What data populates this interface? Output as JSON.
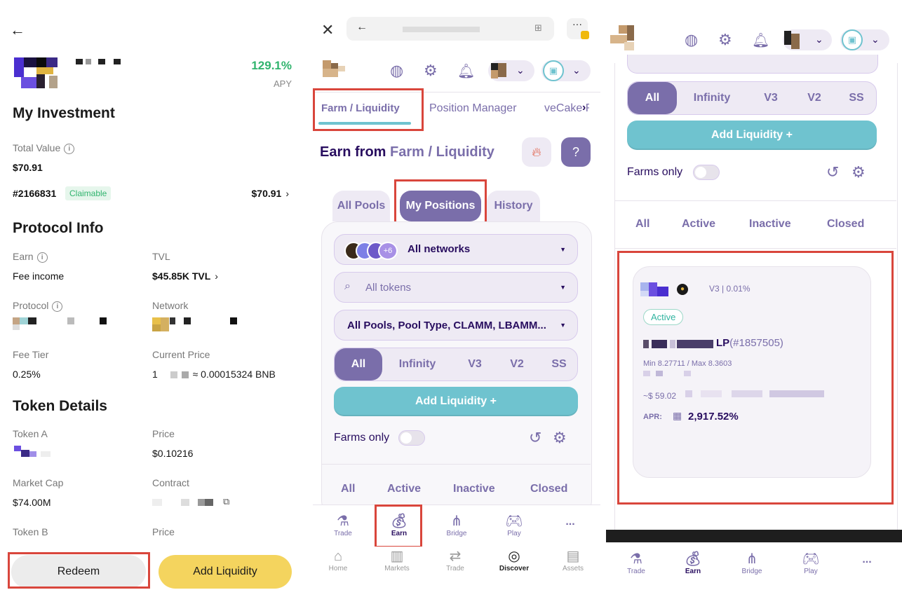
{
  "panel1": {
    "apy_value": "129.1%",
    "apy_label": "APY",
    "my_investment": {
      "heading": "My Investment",
      "total_value_label": "Total Value",
      "total_value": "$70.91",
      "position_id": "#2166831",
      "badge": "Claimable",
      "position_value": "$70.91"
    },
    "protocol_info": {
      "heading": "Protocol Info",
      "earn_label": "Earn",
      "earn_value": "Fee income",
      "tvl_label": "TVL",
      "tvl_value": "$45.85K TVL",
      "protocol_label": "Protocol",
      "network_label": "Network",
      "fee_tier_label": "Fee Tier",
      "fee_tier_value": "0.25%",
      "current_price_label": "Current Price",
      "current_price_prefix": "1",
      "current_price_value": "≈ 0.00015324 BNB"
    },
    "token_details": {
      "heading": "Token Details",
      "token_a_label": "Token A",
      "price_label": "Price",
      "price_value": "$0.10216",
      "market_cap_label": "Market Cap",
      "market_cap_value": "$74.00M",
      "contract_label": "Contract",
      "token_b_label": "Token B",
      "price_b_label": "Price"
    },
    "redeem_label": "Redeem",
    "add_liquidity_label": "Add Liquidity"
  },
  "panel2": {
    "tabs": [
      "Farm / Liquidity",
      "Position Manager",
      "veCake Re"
    ],
    "title_prefix": "Earn from",
    "title_highlight": "Farm / Liquidity",
    "subtabs": [
      "All Pools",
      "My Positions",
      "History"
    ],
    "network_badge": "+6",
    "network_select": "All networks",
    "token_select": "All tokens",
    "pool_select": "All Pools, Pool Type, CLAMM, LBAMM...",
    "segments": [
      "All",
      "Infinity",
      "V3",
      "V2",
      "SS"
    ],
    "add_liquidity": "Add Liquidity  +",
    "farms_only": "Farms only",
    "status_tabs": [
      "All",
      "Active",
      "Inactive",
      "Closed"
    ],
    "nav_top": [
      "Trade",
      "Earn",
      "Bridge",
      "Play",
      "..."
    ],
    "nav_bottom": [
      "Home",
      "Markets",
      "Trade",
      "Discover",
      "Assets"
    ]
  },
  "panel3": {
    "segments": [
      "All",
      "Infinity",
      "V3",
      "V2",
      "SS"
    ],
    "add_liquidity": "Add Liquidity  +",
    "farms_only": "Farms only",
    "status_tabs": [
      "All",
      "Active",
      "Inactive",
      "Closed"
    ],
    "card": {
      "version": "V3 | 0.01%",
      "status": "Active",
      "lp_label": "LP",
      "lp_id": "(#1857505)",
      "range": "Min 8.27711 / Max 8.3603",
      "value": "~$ 59.02",
      "apr_label": "APR:",
      "apr_value": "2,917.52%"
    },
    "nav": [
      "Trade",
      "Earn",
      "Bridge",
      "Play",
      "..."
    ]
  },
  "colors": {
    "accent_purple": "#7a6eaa",
    "dark_purple": "#280d5f",
    "teal": "#6fc3cf",
    "highlight_red": "#d9463c",
    "apy_green": "#31b46e",
    "add_liquidity_yellow": "#f4d45e"
  }
}
